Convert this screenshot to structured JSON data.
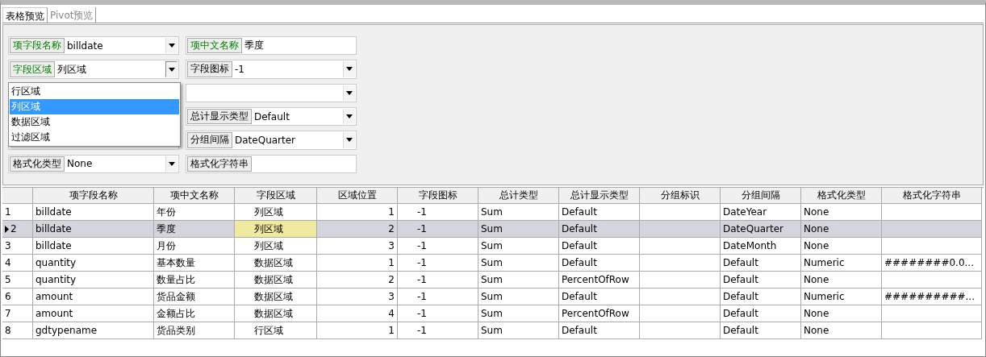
{
  "tabs": [
    {
      "label": "表格预览",
      "selected": true
    },
    {
      "label": "Pivot预览",
      "selected": false
    }
  ],
  "form": {
    "left_fields": [
      {
        "kind": "combo",
        "label": "项字段名称",
        "required": true,
        "value": "billdate",
        "open": false
      },
      {
        "kind": "combo",
        "label": "字段区域",
        "required": true,
        "value": "列区域",
        "open": true
      },
      {
        "kind": "covered"
      },
      {
        "kind": "covered"
      },
      {
        "kind": "covered"
      },
      {
        "kind": "combo",
        "label": "格式化类型",
        "required": false,
        "value": "None",
        "open": false
      }
    ],
    "right_fields": [
      {
        "kind": "text",
        "label": "项中文名称",
        "required": true,
        "value": "季度"
      },
      {
        "kind": "combo",
        "label": "字段图标",
        "required": false,
        "value": "-1",
        "open": false
      },
      {
        "kind": "combo",
        "open": false
      },
      {
        "kind": "combo",
        "label": "总计显示类型",
        "required": false,
        "value": "Default",
        "open": false
      },
      {
        "kind": "combo",
        "label": "分组间隔",
        "required": false,
        "value": "DateQuarter",
        "open": false
      },
      {
        "kind": "text",
        "label": "格式化字符串",
        "required": false
      }
    ],
    "dropdown": {
      "items": [
        {
          "label": "行区域",
          "selected": false
        },
        {
          "label": "列区域",
          "selected": true
        },
        {
          "label": "数据区域",
          "selected": false
        },
        {
          "label": "过滤区域",
          "selected": false
        }
      ]
    }
  },
  "grid": {
    "columns": [
      {
        "label": "项字段名称",
        "kind": "text"
      },
      {
        "label": "项中文名称",
        "kind": "text"
      },
      {
        "label": "字段区域",
        "kind": "center"
      },
      {
        "label": "区域位置",
        "kind": "number"
      },
      {
        "label": "字段图标",
        "kind": "center"
      },
      {
        "label": "总计类型",
        "kind": "text"
      },
      {
        "label": "总计显示类型",
        "kind": "text"
      },
      {
        "label": "分组标识",
        "kind": "text"
      },
      {
        "label": "分组间隔",
        "kind": "text"
      },
      {
        "label": "格式化类型",
        "kind": "text"
      },
      {
        "label": "格式化字符串",
        "kind": "text"
      }
    ],
    "rows": [
      {
        "number": "1",
        "selected": false,
        "cells": [
          "billdate",
          "年份",
          "列区域",
          "1",
          "-1",
          "Sum",
          "Default",
          null,
          "DateYear",
          "None",
          null
        ]
      },
      {
        "number": "2",
        "selected": true,
        "focus": [
          false,
          false,
          true,
          false,
          false,
          false,
          false,
          false,
          false,
          false,
          false
        ],
        "cells": [
          "billdate",
          "季度",
          "列区域",
          "2",
          "-1",
          "Sum",
          "Default",
          null,
          "DateQuarter",
          "None",
          null
        ]
      },
      {
        "number": "3",
        "selected": false,
        "cells": [
          "billdate",
          "月份",
          "列区域",
          "3",
          "-1",
          "Sum",
          "Default",
          null,
          "DateMonth",
          "None",
          null
        ]
      },
      {
        "number": "4",
        "selected": false,
        "cells": [
          "quantity",
          "基本数量",
          "数据区域",
          "1",
          "-1",
          "Sum",
          "Default",
          null,
          "Default",
          "Numeric",
          "########0.0..."
        ]
      },
      {
        "number": "5",
        "selected": false,
        "cells": [
          "quantity",
          "数量占比",
          "数据区域",
          "2",
          "-1",
          "Sum",
          "PercentOfRow",
          null,
          "Default",
          "None",
          null
        ]
      },
      {
        "number": "6",
        "selected": false,
        "cells": [
          "amount",
          "货品金额",
          "数据区域",
          "3",
          "-1",
          "Sum",
          "Default",
          null,
          "Default",
          "Numeric",
          "##########..."
        ]
      },
      {
        "number": "7",
        "selected": false,
        "cells": [
          "amount",
          "金额占比",
          "数据区域",
          "4",
          "-1",
          "Sum",
          "PercentOfRow",
          null,
          "Default",
          "None",
          null
        ]
      },
      {
        "number": "8",
        "selected": false,
        "cells": [
          "gdtypename",
          "货品类别",
          "行区域",
          "1",
          "-1",
          "Sum",
          "Default",
          null,
          "Default",
          "None",
          null
        ]
      }
    ]
  }
}
